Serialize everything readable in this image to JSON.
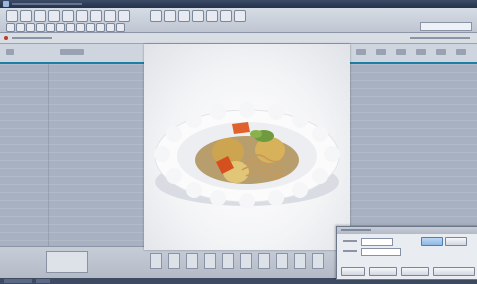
{
  "window": {
    "title_icon": "app-icon"
  },
  "toolbar": {
    "icons": [
      "new-icon",
      "open-icon",
      "save-icon",
      "print-icon",
      "cut-icon",
      "copy-icon",
      "paste-icon",
      "undo-icon",
      "redo-icon",
      "search-icon",
      "edit-icon",
      "table-icon",
      "chart-icon",
      "image-icon",
      "settings-icon",
      "help-icon"
    ]
  },
  "photo": {
    "subject": "bowl-of-simmered-vegetables",
    "colors": {
      "bowl": "#f7f7f8",
      "potato": "#d8b25a",
      "carrot": "#d5501e",
      "noodles": "#c79a5a",
      "greens": "#6f9a3d",
      "broth": "#a27a34"
    }
  },
  "dialog": {
    "buttons": [
      "ok-button",
      "cancel-button",
      "option-button"
    ]
  },
  "colors": {
    "accent": "#1b7fa5",
    "grid": "#a7b1c1",
    "toolbar": "#c9d0db"
  }
}
